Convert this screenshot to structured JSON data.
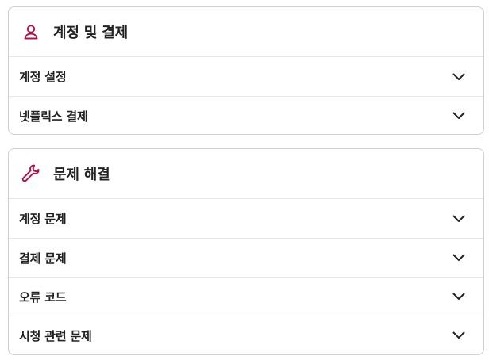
{
  "colors": {
    "accent": "#b0134a",
    "border": "#cfcfcf",
    "divider": "#e6e6e6"
  },
  "account_section": {
    "icon": "person-icon",
    "title": "계정 및 결제",
    "items": [
      {
        "label": "계정 설정"
      },
      {
        "label": "넷플릭스 결제"
      }
    ]
  },
  "troubleshoot_section": {
    "icon": "wrench-icon",
    "title": "문제 해결",
    "items": [
      {
        "label": "계정 문제"
      },
      {
        "label": "결제 문제"
      },
      {
        "label": "오류 코드"
      },
      {
        "label": "시청 관련 문제"
      }
    ]
  }
}
